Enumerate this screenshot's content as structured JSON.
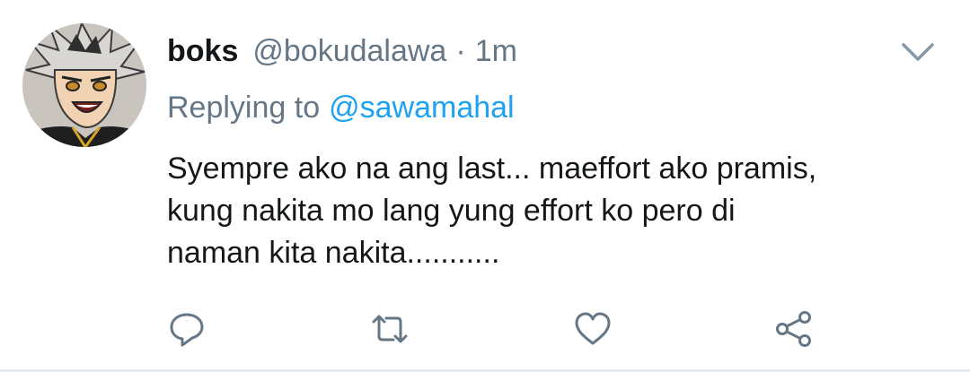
{
  "tweet": {
    "author": {
      "display_name": "boks",
      "handle": "@bokudalawa",
      "avatar_icon": "anime-character-avatar"
    },
    "separator": "·",
    "timestamp": "1m",
    "replying_to_label": "Replying to",
    "replying_to_handle": "@sawamahal",
    "text_lines": [
      "Syempre ako na ang last... maeffort ako pramis,",
      "kung nakita mo lang yung effort ko pero di",
      "naman kita nakita..........."
    ],
    "actions": {
      "reply_icon": "reply-icon",
      "retweet_icon": "retweet-icon",
      "like_icon": "heart-icon",
      "share_icon": "share-icon"
    },
    "menu_icon": "chevron-down-icon"
  },
  "colors": {
    "text_primary": "#14171a",
    "text_secondary": "#657786",
    "link": "#1da1f2",
    "icon": "#657786",
    "divider": "#e6ecf0"
  }
}
